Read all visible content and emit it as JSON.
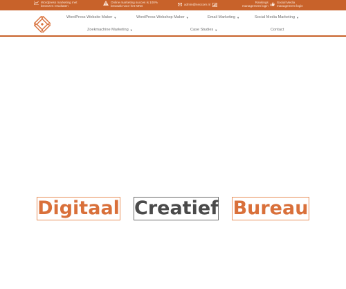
{
  "topbar": {
    "items": [
      {
        "icon": "chart-icon",
        "lines": [
          "Wordpress marketing met",
          "bewezen resultaten"
        ]
      },
      {
        "icon": "warning-icon",
        "lines": [
          "Online marketing succes is 100%",
          "bewaakt voor het MKB"
        ]
      },
      {
        "icon": "email-icon",
        "lines": [
          "admin@seocom.nl"
        ]
      },
      {
        "icon": "report-icon",
        "lines": [
          "Rankings",
          "management login"
        ]
      },
      {
        "icon": "thumbs-up-icon",
        "lines": [
          "Social Media",
          "management login"
        ]
      }
    ]
  },
  "nav": {
    "items": [
      {
        "label": "WordPress Website Maker",
        "dropdown": true
      },
      {
        "label": "WordPress Webshop Maker",
        "dropdown": true
      },
      {
        "label": "Email Marketing",
        "dropdown": true
      },
      {
        "label": "Social Media Marketing",
        "dropdown": true
      },
      {
        "label": "Zoekmachine Marketing",
        "dropdown": true
      },
      {
        "label": "Case Studies",
        "dropdown": true
      },
      {
        "label": "Contact",
        "dropdown": false
      }
    ]
  },
  "hero": {
    "words": [
      "Digitaal",
      "Creatief",
      "Bureau"
    ]
  },
  "colors": {
    "brand": "#c8622a",
    "accent": "#d9703a",
    "dark": "#4a4a4a"
  }
}
